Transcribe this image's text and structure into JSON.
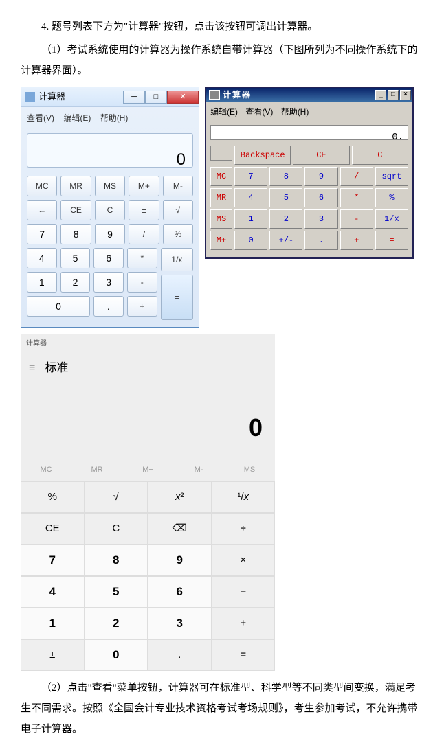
{
  "text": {
    "p1": "4. 题号列表下方为\"计算器\"按钮，点击该按钮可调出计算器。",
    "p2": "（1）考试系统使用的计算器为操作系统自带计算器（下图所列为不同操作系统下的计算器界面）。",
    "p3": "（2）点击\"查看\"菜单按钮，计算器可在标准型、科学型等不同类型间变换，满足考生不同需求。按照《全国会计专业技术资格考试考场规则》，考生参加考试，不允许携带电子计算器。"
  },
  "calc_win7": {
    "title": "计算器",
    "menu": {
      "view": "查看(V)",
      "edit": "编辑(E)",
      "help": "帮助(H)"
    },
    "display": "0",
    "rows": [
      [
        "MC",
        "MR",
        "MS",
        "M+",
        "M-"
      ],
      [
        "←",
        "CE",
        "C",
        "±",
        "√"
      ],
      [
        "7",
        "8",
        "9",
        "/",
        "%"
      ],
      [
        "4",
        "5",
        "6",
        "*",
        "1/x"
      ],
      [
        "1",
        "2",
        "3",
        "-",
        "="
      ],
      [
        "0",
        "",
        ".",
        "+",
        ""
      ]
    ]
  },
  "calc_xp": {
    "title": "计算器",
    "menu": {
      "edit": "编辑(E)",
      "view": "查看(V)",
      "help": "帮助(H)"
    },
    "display": "0.",
    "top": [
      "Backspace",
      "CE",
      "C"
    ],
    "mem": [
      "MC",
      "MR",
      "MS",
      "M+"
    ],
    "grid": [
      [
        "7",
        "8",
        "9",
        "/",
        "sqrt"
      ],
      [
        "4",
        "5",
        "6",
        "*",
        "%"
      ],
      [
        "1",
        "2",
        "3",
        "-",
        "1/x"
      ],
      [
        "0",
        "+/-",
        ".",
        "+",
        "="
      ]
    ]
  },
  "calc_win10": {
    "title": "计算器",
    "mode": "标准",
    "display": "0",
    "mem": [
      "MC",
      "MR",
      "M+",
      "M-",
      "MS"
    ],
    "rows": [
      [
        "%",
        "√",
        "x²",
        "¹/x"
      ],
      [
        "CE",
        "C",
        "⌫",
        "÷"
      ],
      [
        "7",
        "8",
        "9",
        "×"
      ],
      [
        "4",
        "5",
        "6",
        "−"
      ],
      [
        "1",
        "2",
        "3",
        "+"
      ],
      [
        "±",
        "0",
        ".",
        "="
      ]
    ]
  }
}
